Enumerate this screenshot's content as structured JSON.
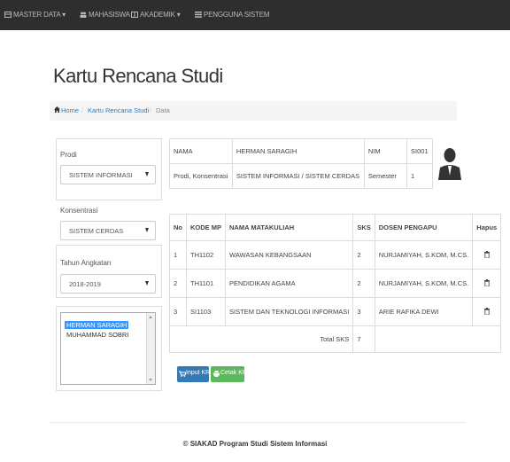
{
  "nav": {
    "master_data": "MASTER DATA ▾",
    "mahasiswa": "MAHASISWA",
    "akademik": "AKADEMIK ▾",
    "pengguna": "PENGGUNA SISTEM"
  },
  "page_title": "Kartu Rencana Studi",
  "breadcrumb": {
    "home": "Home",
    "sep1": "/",
    "krs": "Kartu Rencana Studi",
    "sep2": "/",
    "current": "Data"
  },
  "filters": {
    "prodi_label": "Prodi",
    "prodi_value": "SISTEM INFORMASI",
    "konsentrasi_label": "Konsentrasi",
    "konsentrasi_value": "SISTEM CERDAS",
    "tahun_label": "Tahun Angkatan",
    "tahun_value": "2018-2019"
  },
  "students": [
    "HERMAN SARAGIH",
    "MUHAMMAD SOBRI"
  ],
  "student_info": {
    "nama_label": "NAMA",
    "nama_value": "HERMAN SARAGIH",
    "nim_label": "NIM",
    "nim_value": "SI001",
    "prodi_label": "Prodi, Konsentrasi",
    "prodi_value": "SISTEM INFORMASI / SISTEM CERDAS",
    "semester_label": "Semester",
    "semester_value": "1"
  },
  "krs_table": {
    "headers": {
      "no": "No",
      "kode": "KODE MP",
      "nama": "NAMA MATAKULIAH",
      "sks": "SKS",
      "dosen": "DOSEN PENGAPU",
      "hapus": "Hapus"
    },
    "rows": [
      {
        "no": "1",
        "kode": "TH1102",
        "nama": "WAWASAN KEBANGSAAN",
        "sks": "2",
        "dosen": "NURJAMIYAH, S.KOM, M.CS."
      },
      {
        "no": "2",
        "kode": "TH1101",
        "nama": "PENDIDIKAN AGAMA",
        "sks": "2",
        "dosen": "NURJAMIYAH, S.KOM, M.CS."
      },
      {
        "no": "3",
        "kode": "SI1103",
        "nama": "SISTEM DAN TEKNOLOGI INFORMASI",
        "sks": "3",
        "dosen": "ARIE RAFIKA DEWI"
      }
    ],
    "total_label": "Total SKS",
    "total_value": "7"
  },
  "buttons": {
    "input": "Input KRS",
    "cetak": "Cetak KRS"
  },
  "colors": {
    "navbar": "#2e2e2e",
    "primary": "#337ab7",
    "success": "#5cb85c",
    "selected": "#3399ff"
  },
  "footer": "© SIAKAD Program Studi Sistem Informasi"
}
